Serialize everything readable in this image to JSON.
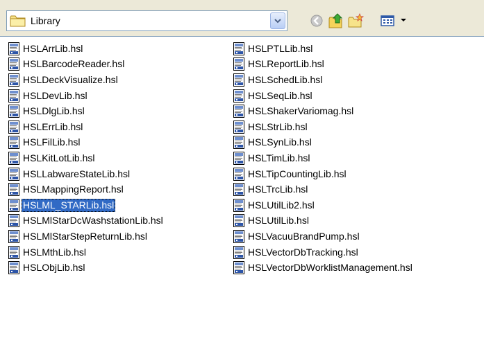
{
  "toolbar": {
    "look_in_value": "Library",
    "icons": [
      "folder-icon",
      "dropdown-arrow-icon",
      "back-icon",
      "up-folder-icon",
      "new-folder-icon",
      "view-menu-icon"
    ]
  },
  "files": {
    "column1": [
      "HSLArrLib.hsl",
      "HSLBarcodeReader.hsl",
      "HSLDeckVisualize.hsl",
      "HSLDevLib.hsl",
      "HSLDlgLib.hsl",
      "HSLErrLib.hsl",
      "HSLFilLib.hsl",
      "HSLKitLotLib.hsl",
      "HSLLabwareStateLib.hsl",
      "HSLMappingReport.hsl",
      "HSLML_STARLib.hsl",
      "HSLMlStarDcWashstationLib.hsl",
      "HSLMlStarStepReturnLib.hsl",
      "HSLMthLib.hsl",
      "HSLObjLib.hsl"
    ],
    "column2": [
      "HSLPTLLib.hsl",
      "HSLReportLib.hsl",
      "HSLSchedLib.hsl",
      "HSLSeqLib.hsl",
      "HSLShakerVariomag.hsl",
      "HSLStrLib.hsl",
      "HSLSynLib.hsl",
      "HSLTimLib.hsl",
      "HSLTipCountingLib.hsl",
      "HSLTrcLib.hsl",
      "HSLUtilLib2.hsl",
      "HSLUtilLib.hsl",
      "HSLVacuuBrandPump.hsl",
      "HSLVectorDbTracking.hsl",
      "HSLVectorDbWorklistManagement.hsl"
    ],
    "selected": "HSLML_STARLib.hsl"
  },
  "colors": {
    "selection": "#316AC5",
    "window_bg": "#ECE9D8"
  }
}
